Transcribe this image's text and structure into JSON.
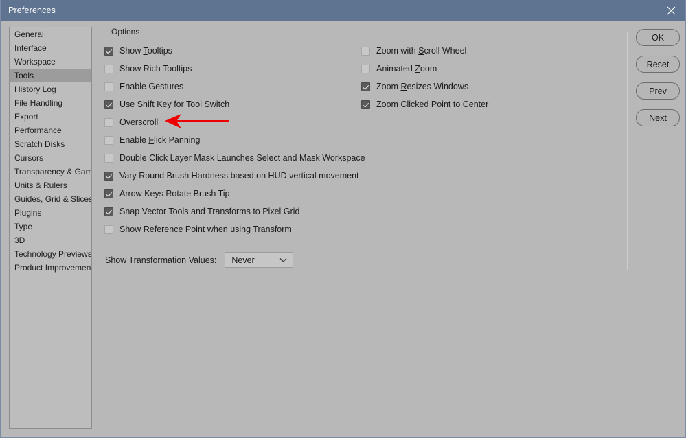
{
  "window": {
    "title": "Preferences",
    "close_icon": "close-icon",
    "titlebar_color": "#5e7490",
    "body_color": "#b8b8b8"
  },
  "sidebar": {
    "selected": "Tools",
    "items": [
      {
        "label": "General",
        "selected": false
      },
      {
        "label": "Interface",
        "selected": false
      },
      {
        "label": "Workspace",
        "selected": false
      },
      {
        "label": "Tools",
        "selected": true
      },
      {
        "label": "History Log",
        "selected": false
      },
      {
        "label": "File Handling",
        "selected": false
      },
      {
        "label": "Export",
        "selected": false
      },
      {
        "label": "Performance",
        "selected": false
      },
      {
        "label": "Scratch Disks",
        "selected": false
      },
      {
        "label": "Cursors",
        "selected": false
      },
      {
        "label": "Transparency & Gamut",
        "selected": false
      },
      {
        "label": "Units & Rulers",
        "selected": false
      },
      {
        "label": "Guides, Grid & Slices",
        "selected": false
      },
      {
        "label": "Plugins",
        "selected": false
      },
      {
        "label": "Type",
        "selected": false
      },
      {
        "label": "3D",
        "selected": false
      },
      {
        "label": "Technology Previews",
        "selected": false
      },
      {
        "label": "Product Improvement",
        "selected": false
      }
    ]
  },
  "options": {
    "legend": "Options",
    "left_column": [
      {
        "label": "Show Tooltips",
        "accel": "T",
        "checked": true
      },
      {
        "label": "Show Rich Tooltips",
        "accel": "",
        "checked": false
      },
      {
        "label": "Enable Gestures",
        "accel": "",
        "checked": false
      },
      {
        "label": "Use Shift Key for Tool Switch",
        "accel": "U",
        "checked": true
      },
      {
        "label": "Overscroll",
        "accel": "",
        "checked": false
      },
      {
        "label": "Enable Flick Panning",
        "accel": "F",
        "checked": false
      },
      {
        "label": "Double Click Layer Mask Launches Select and Mask Workspace",
        "accel": "",
        "checked": false
      },
      {
        "label": "Vary Round Brush Hardness based on HUD vertical movement",
        "accel": "",
        "checked": true
      },
      {
        "label": "Arrow Keys Rotate Brush Tip",
        "accel": "",
        "checked": true
      },
      {
        "label": "Snap Vector Tools and Transforms to Pixel Grid",
        "accel": "",
        "checked": true
      },
      {
        "label": "Show Reference Point when using Transform",
        "accel": "",
        "checked": false
      }
    ],
    "right_column": [
      {
        "label": "Zoom with Scroll Wheel",
        "accel": "S",
        "checked": false
      },
      {
        "label": "Animated Zoom",
        "accel": "Z",
        "checked": false
      },
      {
        "label": "Zoom Resizes Windows",
        "accel": "R",
        "checked": true
      },
      {
        "label": "Zoom Clicked Point to Center",
        "accel": "k",
        "checked": true
      }
    ],
    "transform_values": {
      "label": "Show Transformation Values:",
      "accel": "V",
      "value": "Never",
      "chevron_icon": "chevron-down-icon"
    }
  },
  "buttons": [
    {
      "label": "OK",
      "accel": ""
    },
    {
      "label": "Reset",
      "accel": ""
    },
    {
      "label": "Prev",
      "accel": "P"
    },
    {
      "label": "Next",
      "accel": "N"
    }
  ],
  "annotation": {
    "arrow_icon": "red-arrow-icon",
    "arrow_color": "#ee0000",
    "points_at": "Overscroll"
  }
}
